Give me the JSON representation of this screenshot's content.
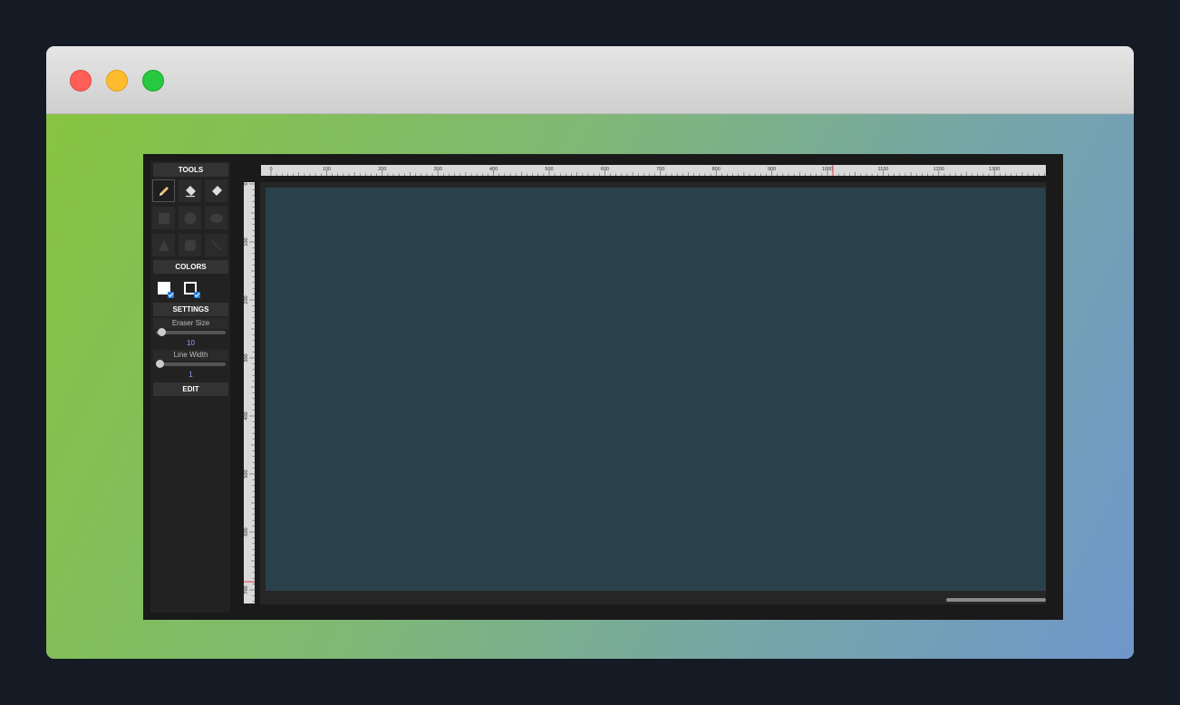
{
  "window": {
    "controls": [
      "close",
      "minimize",
      "maximize"
    ]
  },
  "sidebar": {
    "tools_header": "TOOLS",
    "tools": [
      {
        "name": "pencil",
        "active": true
      },
      {
        "name": "eraser",
        "active": false
      },
      {
        "name": "eraser-alt",
        "active": false
      },
      {
        "name": "rectangle",
        "active": false
      },
      {
        "name": "circle",
        "active": false
      },
      {
        "name": "ellipse",
        "active": false
      },
      {
        "name": "triangle",
        "active": false
      },
      {
        "name": "rounded-rectangle",
        "active": false
      },
      {
        "name": "line",
        "active": false
      }
    ],
    "colors_header": "COLORS",
    "colors": {
      "fill": "#ffffff",
      "stroke": "#ffffff",
      "fill_enabled": true,
      "stroke_enabled": true
    },
    "settings_header": "SETTINGS",
    "settings": {
      "eraser_label": "Eraser Size",
      "eraser_value": "10",
      "line_label": "Line Width",
      "line_value": "1"
    },
    "edit_header": "EDIT"
  },
  "rulers": {
    "top_labels": [
      "0",
      "100",
      "200",
      "300",
      "400",
      "500",
      "600",
      "700",
      "800",
      "900",
      "1000",
      "1100",
      "1200",
      "1300",
      "14"
    ],
    "left_labels": [
      "0",
      "100",
      "200",
      "300",
      "400",
      "500",
      "600",
      "700"
    ]
  },
  "colors": {
    "canvas_bg": "#28414a",
    "app_bg": "#1a1a1a",
    "accent": "#2a7de1",
    "value_text": "#8ea6ff"
  }
}
